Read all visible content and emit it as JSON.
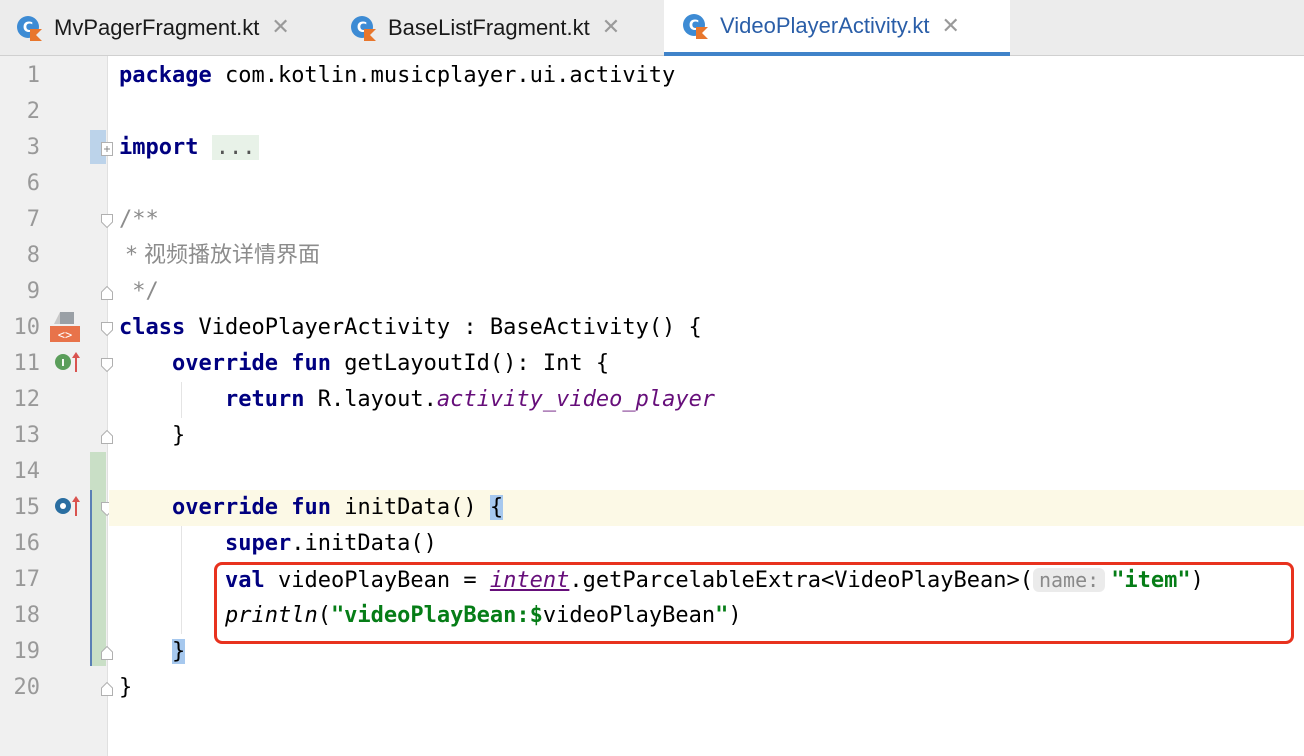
{
  "tabs": [
    {
      "label": "MvPagerFragment.kt",
      "active": false
    },
    {
      "label": "BaseListFragment.kt",
      "active": false
    },
    {
      "label": "VideoPlayerActivity.kt",
      "active": true
    }
  ],
  "tab_close_glyph": "✕",
  "line_numbers": [
    "1",
    "2",
    "3",
    "6",
    "7",
    "8",
    "9",
    "10",
    "11",
    "12",
    "13",
    "14",
    "15",
    "16",
    "17",
    "18",
    "19",
    "20"
  ],
  "code": {
    "l1_kw": "package",
    "l1_rest": " com.kotlin.musicplayer.ui.activity",
    "l3_kw": "import",
    "l3_dots": "...",
    "l7": "/**",
    "l8": " * 视频播放详情界面",
    "l9": " */",
    "l10_kw": "class",
    "l10_rest": " VideoPlayerActivity : BaseActivity() {",
    "l11_kw1": "override",
    "l11_kw2": "fun",
    "l11_rest": " getLayoutId(): Int {",
    "l12_kw": "return",
    "l12_mid": " R.layout.",
    "l12_prop": "activity_video_player",
    "l13": "}",
    "l15_kw1": "override",
    "l15_kw2": "fun",
    "l15_rest": " initData() ",
    "l15_brace": "{",
    "l16_kw": "super",
    "l16_rest": ".initData()",
    "l17_kw": "val",
    "l17_a": " videoPlayBean = ",
    "l17_ext": "intent",
    "l17_b": ".getParcelableExtra<VideoPlayBean>(",
    "l17_hint": "name:",
    "l17_str": "\"item\"",
    "l17_end": ")",
    "l18_fn": "println",
    "l18_open": "(",
    "l18_str": "\"videoPlayBean:",
    "l18_dollar": "$",
    "l18_var": "videoPlayBean",
    "l18_strend": "\"",
    "l18_close": ")",
    "l19_brace": "}",
    "l20": "}"
  },
  "gutter_icons": {
    "line10": "android-layout-icon",
    "line11": "implements-up-arrow-icon",
    "line15": "overrides-up-arrow-icon"
  },
  "colors": {
    "keyword": "#000080",
    "string": "#067d17",
    "property": "#660e7a",
    "comment": "#8c8c8c",
    "highlight_box": "#e8321e",
    "tab_underline": "#4083c9",
    "current_line": "#fcf9e6"
  }
}
